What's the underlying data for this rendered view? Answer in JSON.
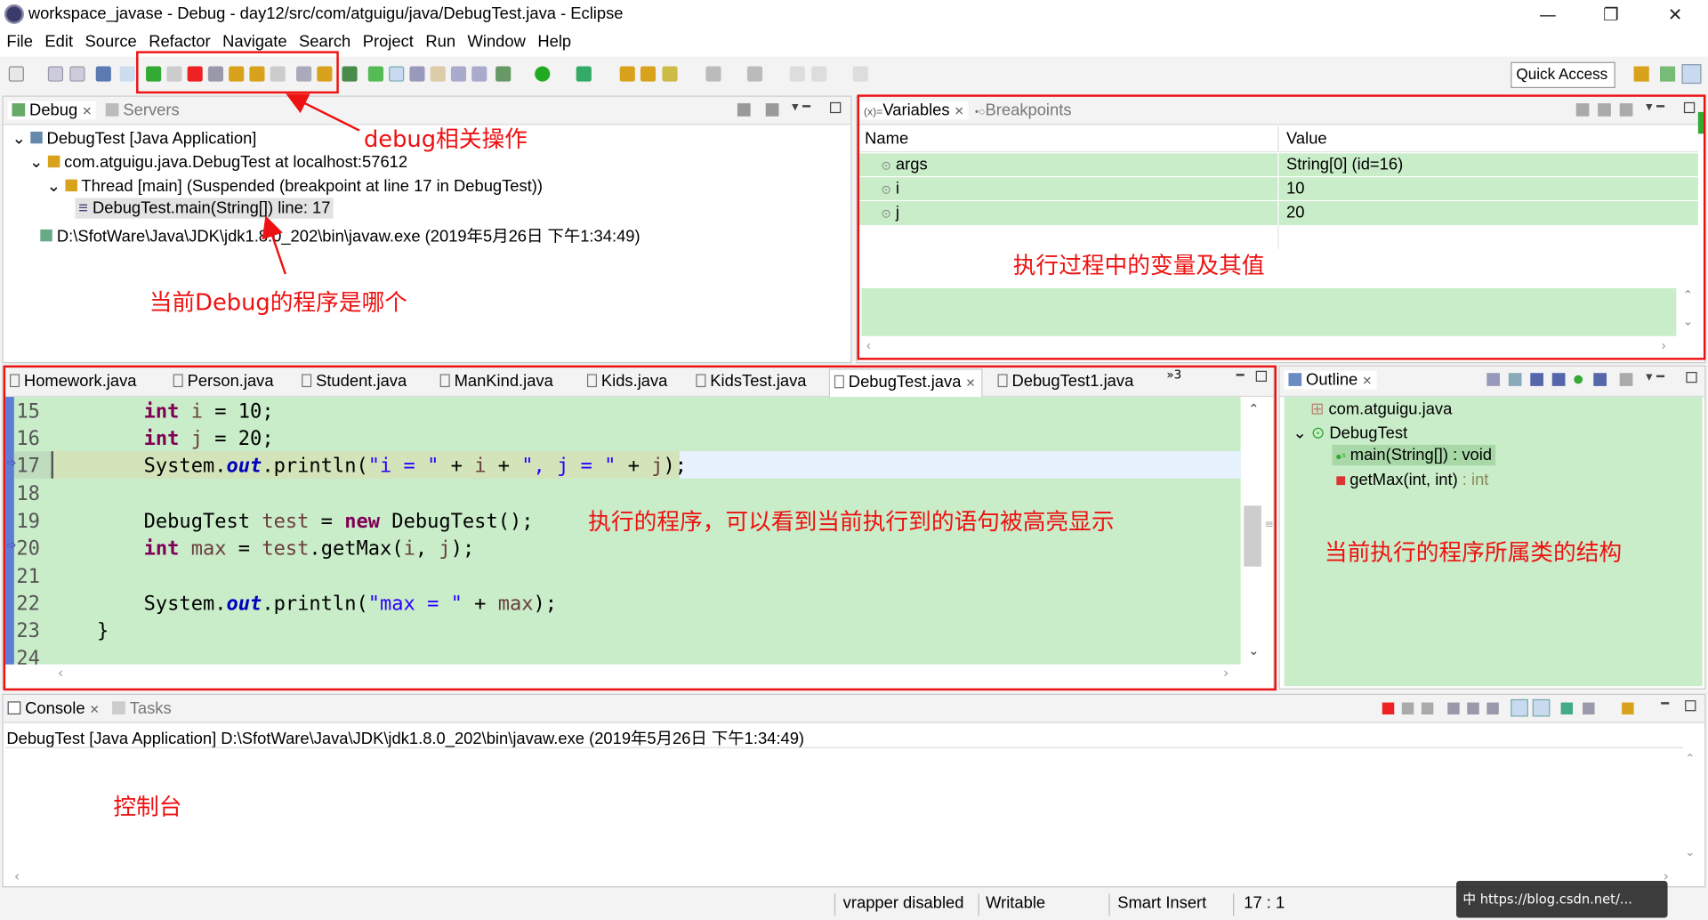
{
  "window": {
    "title": "workspace_javase - Debug - day12/src/com/atguigu/java/DebugTest.java - Eclipse",
    "minimize": "—",
    "restore": "❐",
    "close": "✕"
  },
  "menu": [
    "File",
    "Edit",
    "Source",
    "Refactor",
    "Navigate",
    "Search",
    "Project",
    "Run",
    "Window",
    "Help"
  ],
  "quick_access": "Quick Access",
  "debug_view": {
    "tabs": [
      "Debug",
      "Servers"
    ],
    "items": [
      "DebugTest [Java Application]",
      "com.atguigu.java.DebugTest at localhost:57612",
      "Thread [main] (Suspended (breakpoint at line 17 in DebugTest))",
      "DebugTest.main(String[]) line: 17",
      "D:\\SfotWare\\Java\\JDK\\jdk1.8.0_202\\bin\\javaw.exe (2019年5月26日 下午1:34:49)"
    ]
  },
  "variables_view": {
    "tabs": [
      "Variables",
      "Breakpoints"
    ],
    "columns": [
      "Name",
      "Value"
    ],
    "rows": [
      {
        "name": "args",
        "value": "String[0]  (id=16)"
      },
      {
        "name": "i",
        "value": "10"
      },
      {
        "name": "j",
        "value": "20"
      }
    ]
  },
  "editor": {
    "tabs": [
      "Homework.java",
      "Person.java",
      "Student.java",
      "ManKind.java",
      "Kids.java",
      "KidsTest.java",
      "DebugTest.java",
      "DebugTest1.java"
    ],
    "overflow": "»3",
    "line_numbers": [
      "15",
      "16",
      "17",
      "18",
      "19",
      "20",
      "21",
      "22",
      "23",
      "24"
    ],
    "current_line": "17"
  },
  "outline_view": {
    "tab": "Outline",
    "items": [
      "com.atguigu.java",
      "DebugTest",
      "main(String[]) : void",
      "getMax(int, int)",
      " : int"
    ]
  },
  "console_view": {
    "tabs": [
      "Console",
      "Tasks"
    ],
    "launch": "DebugTest [Java Application] D:\\SfotWare\\Java\\JDK\\jdk1.8.0_202\\bin\\javaw.exe (2019年5月26日 下午1:34:49)"
  },
  "status_bar": {
    "vrapper": "vrapper disabled",
    "writable": "Writable",
    "insert": "Smart Insert",
    "position": "17 : 1"
  },
  "annotations": {
    "debug_ops": "debug相关操作",
    "current_program": "当前Debug的程序是哪个",
    "variables": "执行过程中的变量及其值",
    "code": "执行的程序，可以看到当前执行到的语句被高亮显示",
    "outline": "当前执行的程序所属类的结构",
    "console": "控制台"
  },
  "watermark": "中 https://blog.csdn.net/... "
}
